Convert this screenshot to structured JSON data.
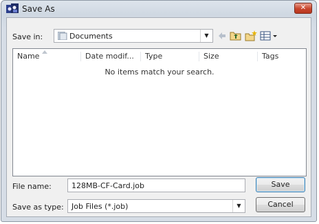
{
  "window": {
    "title": "Save As"
  },
  "toolbar": {
    "save_in_label": "Save in:",
    "save_in_value": "Documents",
    "icons": [
      "back-arrow-icon",
      "up-folder-icon",
      "new-folder-icon",
      "view-menu-icon"
    ]
  },
  "list": {
    "columns": [
      "Name",
      "Date modif...",
      "Type",
      "Size",
      "Tags"
    ],
    "empty_message": "No items match your search."
  },
  "form": {
    "file_name_label": "File name:",
    "file_name_value": "128MB-CF-Card.job",
    "save_as_type_label": "Save as type:",
    "save_as_type_value": "Job Files (*.job)"
  },
  "buttons": {
    "save": "Save",
    "cancel": "Cancel"
  },
  "colors": {
    "close_button": "#c8442b",
    "title_bar": "#d6dde6",
    "client_bg": "#f0f0f0"
  }
}
